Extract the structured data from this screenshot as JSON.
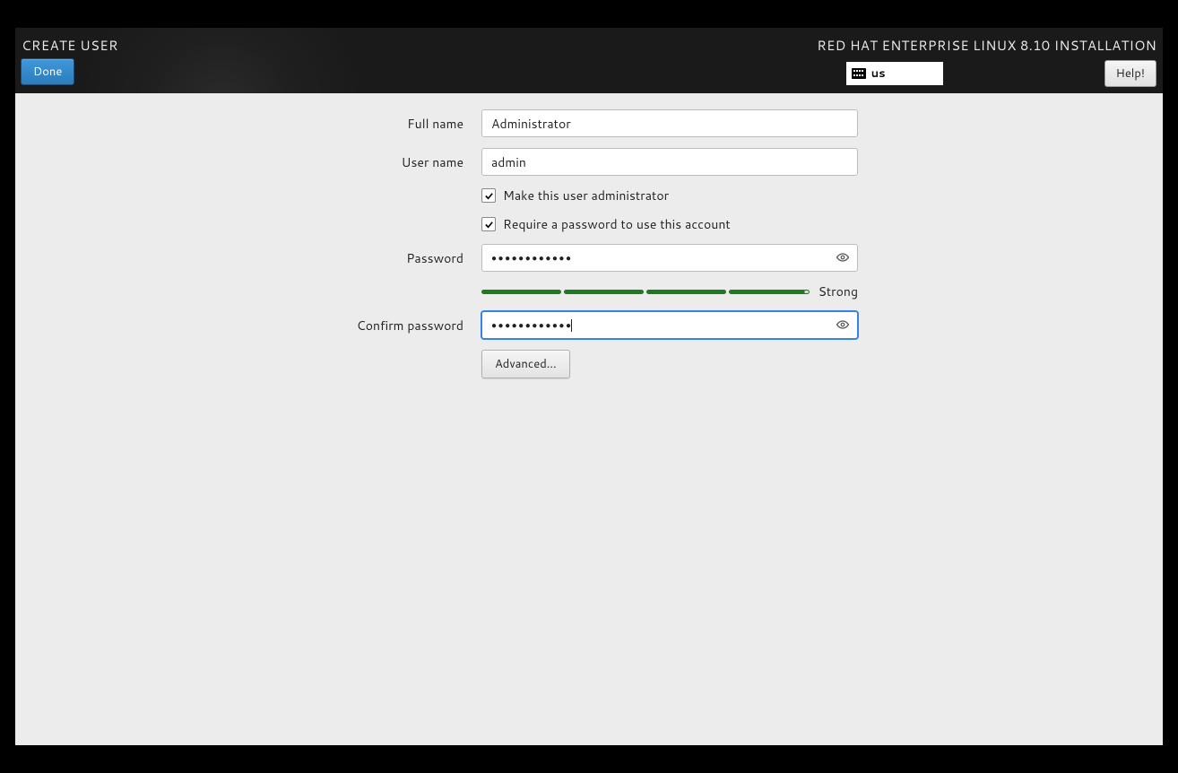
{
  "header": {
    "page_title": "CREATE USER",
    "done_label": "Done",
    "product_title": "RED HAT ENTERPRISE LINUX 8.10 INSTALLATION",
    "keyboard_layout": "us",
    "help_label": "Help!"
  },
  "form": {
    "full_name": {
      "label": "Full name",
      "value": "Administrator"
    },
    "user_name": {
      "label": "User name",
      "value": "admin"
    },
    "make_admin": {
      "label": "Make this user administrator",
      "checked": true
    },
    "require_password": {
      "label": "Require a password to use this account",
      "checked": true
    },
    "password": {
      "label": "Password",
      "value": "●●●●●●●●●●●●"
    },
    "strength": {
      "label": "Strong",
      "level": 4
    },
    "confirm_password": {
      "label": "Confirm password",
      "value": "●●●●●●●●●●●●"
    },
    "advanced_label": "Advanced..."
  }
}
